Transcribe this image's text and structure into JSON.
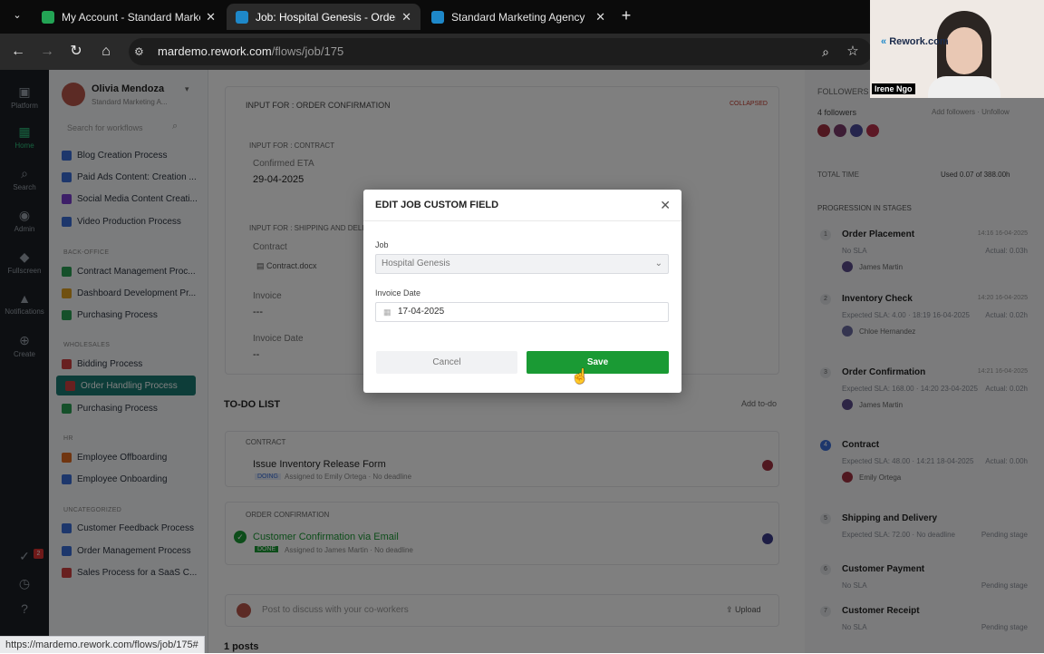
{
  "browser": {
    "tabs": [
      {
        "title": "My Account - Standard Marketi",
        "color": "#23a455"
      },
      {
        "title": "Job: Hospital Genesis - Order H",
        "color": "#1e88c9"
      },
      {
        "title": "Standard Marketing Agency",
        "color": "#1e88c9"
      }
    ],
    "url_host": "mardemo.rework.com",
    "url_path": "/flows/job/175"
  },
  "iconbar": {
    "items": [
      "Platform",
      "Home",
      "Search",
      "Admin",
      "Fullscreen",
      "Notifications",
      "Create"
    ],
    "badge": "2"
  },
  "sidebar": {
    "user_name": "Olivia Mendoza",
    "user_company": "Standard Marketing A...",
    "search_placeholder": "Search for workflows",
    "items_top": [
      {
        "label": "Blog Creation Process",
        "color": "#3b6fd8"
      },
      {
        "label": "Paid Ads Content: Creation ...",
        "color": "#3b6fd8"
      },
      {
        "label": "Social Media Content Creati...",
        "color": "#7b3fd0"
      },
      {
        "label": "Video Production Process",
        "color": "#3b6fd8"
      }
    ],
    "section_backoffice": "BACK-OFFICE",
    "items_backoffice": [
      {
        "label": "Contract Management Proc...",
        "color": "#2aa055"
      },
      {
        "label": "Dashboard Development Pr...",
        "color": "#e0a020"
      },
      {
        "label": "Purchasing Process",
        "color": "#2aa055"
      }
    ],
    "section_wholesales": "WHOLESALES",
    "items_wholesales": [
      {
        "label": "Bidding Process",
        "color": "#d04040"
      },
      {
        "label": "Order Handling Process",
        "color": "#d04040"
      },
      {
        "label": "Purchasing Process",
        "color": "#2aa055"
      }
    ],
    "section_hr": "HR",
    "items_hr": [
      {
        "label": "Employee Offboarding",
        "color": "#e06a20"
      },
      {
        "label": "Employee Onboarding",
        "color": "#3b6fd8"
      }
    ],
    "section_uncategorized": "UNCATEGORIZED",
    "items_uncategorized": [
      {
        "label": "Customer Feedback Process",
        "color": "#3b6fd8"
      },
      {
        "label": "Order Management Process",
        "color": "#3b6fd8"
      },
      {
        "label": "Sales Process for a SaaS C...",
        "color": "#d04040"
      }
    ]
  },
  "main": {
    "input_header": "INPUT FOR : ORDER CONFIRMATION",
    "collapsed": "COLLAPSED",
    "contract_header": "INPUT FOR : CONTRACT",
    "confirmed_eta_label": "Confirmed ETA",
    "confirmed_eta_value": "29-04-2025",
    "shipping_header": "INPUT FOR : SHIPPING AND DELI...",
    "contract_label": "Contract",
    "contract_file": "Contract.docx",
    "invoice_label": "Invoice",
    "invoice_value": "---",
    "invoice_date_label": "Invoice Date",
    "invoice_date_value": "--",
    "todo_title": "TO-DO LIST",
    "add_todo": "Add to-do",
    "todo_group1": "CONTRACT",
    "todo1_title": "Issue Inventory Release Form",
    "todo1_status": "DOING",
    "todo1_meta": "Assigned to Emily Ortega · No deadline",
    "todo_group2": "ORDER CONFIRMATION",
    "todo2_title": "Customer Confirmation via Email",
    "todo2_status": "DONE",
    "todo2_meta": "Assigned to James Martin · No deadline",
    "post_placeholder": "Post to discuss with your co-workers",
    "upload": "Upload",
    "posts_count": "1 posts"
  },
  "right": {
    "followers_title": "FOLLOWERS",
    "followers_count": "4 followers",
    "add_followers": "Add followers · Unfollow",
    "total_time_label": "TOTAL TIME",
    "total_time_value": "Used 0.07 of 388.00h",
    "progression_title": "PROGRESSION IN STAGES",
    "stages": [
      {
        "n": "1",
        "name": "Order Placement",
        "time": "14:16 16-04-2025",
        "sla": "No SLA",
        "actual": "Actual: 0.03h",
        "who": "James Martin"
      },
      {
        "n": "2",
        "name": "Inventory Check",
        "time": "14:20 16-04-2025",
        "sla": "Expected SLA: 4.00 · 18:19 16-04-2025",
        "actual": "Actual: 0.02h",
        "who": "Chloe Hernandez"
      },
      {
        "n": "3",
        "name": "Order Confirmation",
        "time": "14:21 16-04-2025",
        "sla": "Expected SLA: 168.00 · 14:20 23-04-2025",
        "actual": "Actual: 0.02h",
        "who": "James Martin"
      },
      {
        "n": "4",
        "name": "Contract",
        "time": "",
        "sla": "Expected SLA: 48.00 · 14:21 18-04-2025",
        "actual": "Actual: 0.00h",
        "who": "Emily Ortega"
      },
      {
        "n": "5",
        "name": "Shipping and Delivery",
        "time": "",
        "sla": "Expected SLA: 72.00 · No deadline",
        "actual": "Pending stage",
        "who": ""
      },
      {
        "n": "6",
        "name": "Customer Payment",
        "time": "",
        "sla": "No SLA",
        "actual": "Pending stage",
        "who": ""
      },
      {
        "n": "7",
        "name": "Customer Receipt",
        "time": "",
        "sla": "No SLA",
        "actual": "Pending stage",
        "who": ""
      }
    ]
  },
  "dialog": {
    "title": "EDIT JOB CUSTOM FIELD",
    "job_label": "Job",
    "job_value": "Hospital Genesis",
    "invoice_date_label": "Invoice Date",
    "invoice_date_value": "17-04-2025",
    "cancel": "Cancel",
    "save": "Save"
  },
  "status_url": "https://mardemo.rework.com/flows/job/175#",
  "webcam": {
    "name": "Irene Ngo",
    "logo_text": "Rework.com"
  }
}
